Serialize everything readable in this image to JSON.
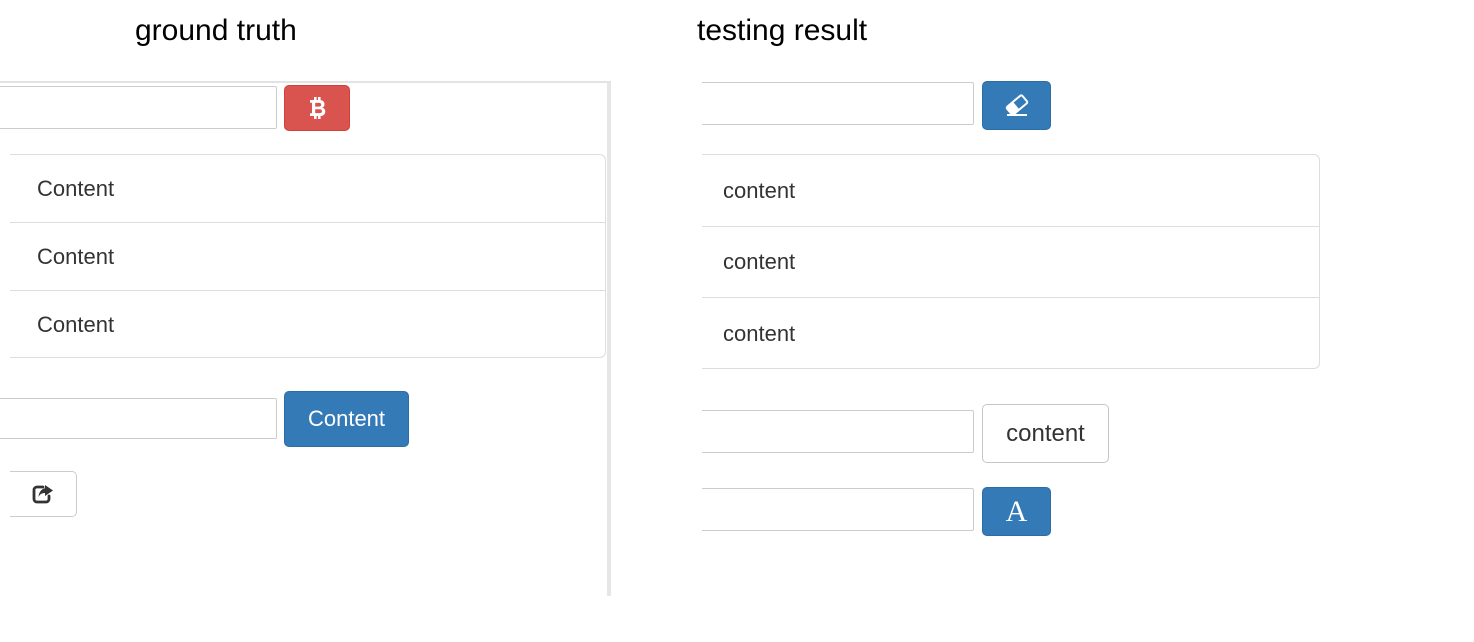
{
  "headings": {
    "left": "ground truth",
    "right": "testing result"
  },
  "ground_truth": {
    "top_input": {
      "value": "",
      "placeholder": ""
    },
    "top_button": {
      "icon": "bitcoin-icon",
      "color": "#d9534f"
    },
    "list_items": [
      "Content",
      "Content",
      "Content"
    ],
    "second_input": {
      "value": "",
      "placeholder": ""
    },
    "second_button": {
      "label": "Content",
      "color": "#337ab7"
    },
    "share_button": {
      "icon": "share-square-icon"
    }
  },
  "testing_result": {
    "top_input": {
      "value": "",
      "placeholder": ""
    },
    "top_button": {
      "icon": "eraser-icon",
      "color": "#337ab7"
    },
    "list_items": [
      "content",
      "content",
      "content"
    ],
    "second_input": {
      "value": "",
      "placeholder": ""
    },
    "second_button": {
      "label": "content"
    },
    "third_input": {
      "value": "",
      "placeholder": ""
    },
    "third_button": {
      "label": "A",
      "color": "#337ab7"
    }
  }
}
